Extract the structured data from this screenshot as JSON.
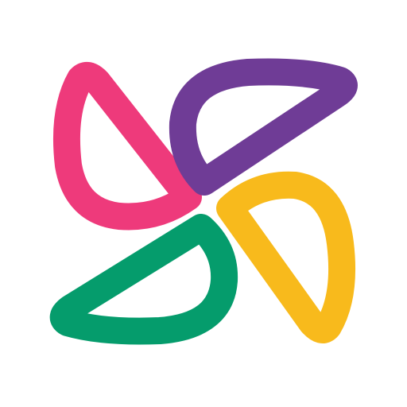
{
  "logo": {
    "name": "pinwheel-logo",
    "petals": [
      {
        "name": "pink-petal",
        "color": "#EE3A7B"
      },
      {
        "name": "purple-petal",
        "color": "#6F3C96"
      },
      {
        "name": "yellow-petal",
        "color": "#F8BA1C"
      },
      {
        "name": "green-petal",
        "color": "#059C6C"
      }
    ]
  },
  "background": "#FFFFFF"
}
